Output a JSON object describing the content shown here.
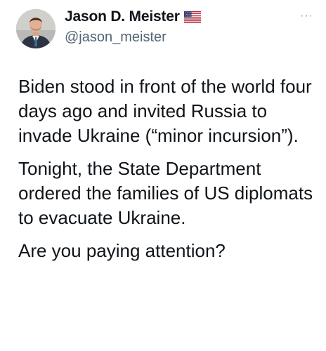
{
  "author": {
    "name": "Jason D. Meister",
    "handle": "@jason_meister",
    "flag_icon": "us-flag-icon",
    "avatar_icon": "profile-photo"
  },
  "menu": {
    "icon": "more-options-icon",
    "glyph": "···"
  },
  "tweet": {
    "paragraphs": [
      "Biden stood in front of the world four days ago and invited Russia to invade Ukraine (“minor incursion”).",
      "Tonight, the State Department ordered the families of US diplomats to evacuate Ukraine.",
      "Are you paying attention?"
    ]
  },
  "colors": {
    "text": "#0f1419",
    "secondary": "#536471",
    "background": "#ffffff"
  }
}
